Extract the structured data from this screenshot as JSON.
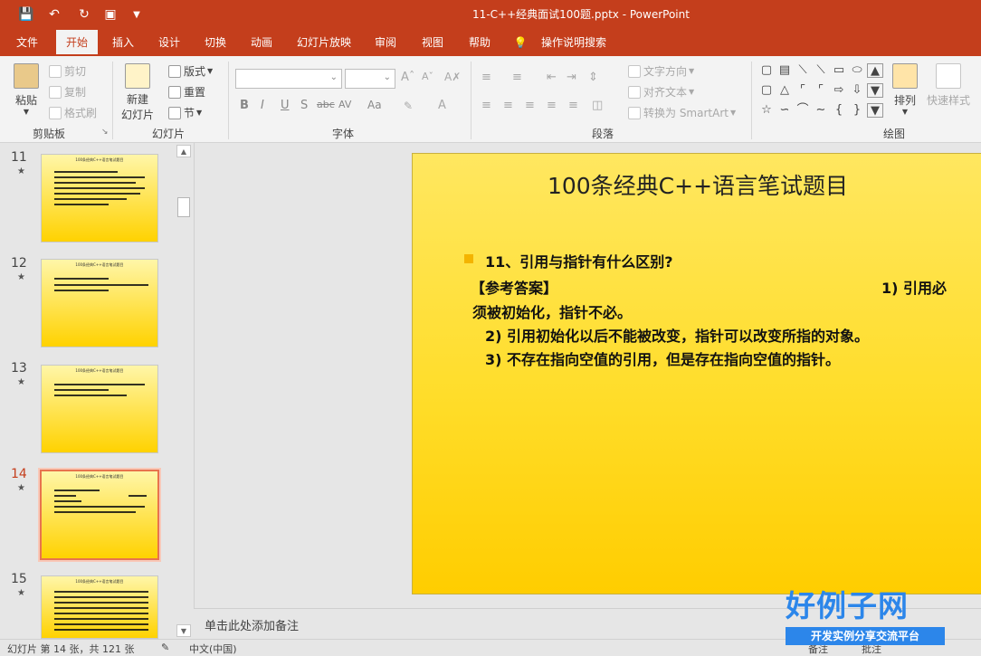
{
  "app": {
    "window_title": "11-C++经典面试100题.pptx  -  PowerPoint",
    "accent_color": "#c43e1c"
  },
  "quick_access": {
    "icons": [
      "save-icon",
      "undo-icon",
      "redo-icon",
      "present-from-start-icon",
      "customize-qat-icon"
    ]
  },
  "tabs": [
    {
      "label": "文件"
    },
    {
      "label": "开始",
      "active": true
    },
    {
      "label": "插入"
    },
    {
      "label": "设计"
    },
    {
      "label": "切换"
    },
    {
      "label": "动画"
    },
    {
      "label": "幻灯片放映"
    },
    {
      "label": "审阅"
    },
    {
      "label": "视图"
    },
    {
      "label": "帮助"
    },
    {
      "label": "操作说明搜索"
    }
  ],
  "ribbon": {
    "clipboard": {
      "paste": "粘贴",
      "cut": "剪切",
      "copy": "复制",
      "format_painter": "格式刷",
      "group_label": "剪贴板"
    },
    "slides": {
      "new_slide_line1": "新建",
      "new_slide_line2": "幻灯片",
      "layout": "版式",
      "reset": "重置",
      "section": "节",
      "group_label": "幻灯片"
    },
    "font": {
      "font_name": "",
      "font_size": "",
      "bold": "B",
      "italic": "I",
      "underline": "U",
      "shadow": "S",
      "strike": "abc",
      "spacing": "AV",
      "case": "Aa",
      "group_label": "字体"
    },
    "paragraph": {
      "text_direction": "文字方向",
      "align_text": "对齐文本",
      "convert_smartart": "转换为 SmartArt",
      "group_label": "段落"
    },
    "drawing": {
      "arrange": "排列",
      "quick_styles": "快速样式",
      "group_label": "绘图"
    }
  },
  "slide_panel": {
    "slides": [
      {
        "number": "11",
        "title": "100条经典C++语言笔试题目"
      },
      {
        "number": "12",
        "title": "100条经典C++语言笔试题目"
      },
      {
        "number": "13",
        "title": "100条经典C++语言笔试题目"
      },
      {
        "number": "14",
        "title": "100条经典C++语言笔试题目",
        "active": true
      },
      {
        "number": "15",
        "title": "100条经典C++语言笔试题目"
      }
    ]
  },
  "slide": {
    "title": "100条经典C++语言笔试题目",
    "question": "11、引用与指针有什么区别?",
    "answer_label": "【参考答案】",
    "answer_right": "1) 引用必",
    "line1": "须被初始化，指针不必。",
    "line2": "2) 引用初始化以后不能被改变，指针可以改变所指的对象。",
    "line3": "3) 不存在指向空值的引用，但是存在指向空值的指针。"
  },
  "notes": {
    "placeholder": "单击此处添加备注"
  },
  "status_bar": {
    "slide_info": "幻灯片 第 14 张，共 121 张",
    "language": "中文(中国)",
    "notes_btn": "备注",
    "comments_btn": "批注"
  },
  "overlay": {
    "brand": "好例子网",
    "tagline": "开发实例分享交流平台"
  }
}
